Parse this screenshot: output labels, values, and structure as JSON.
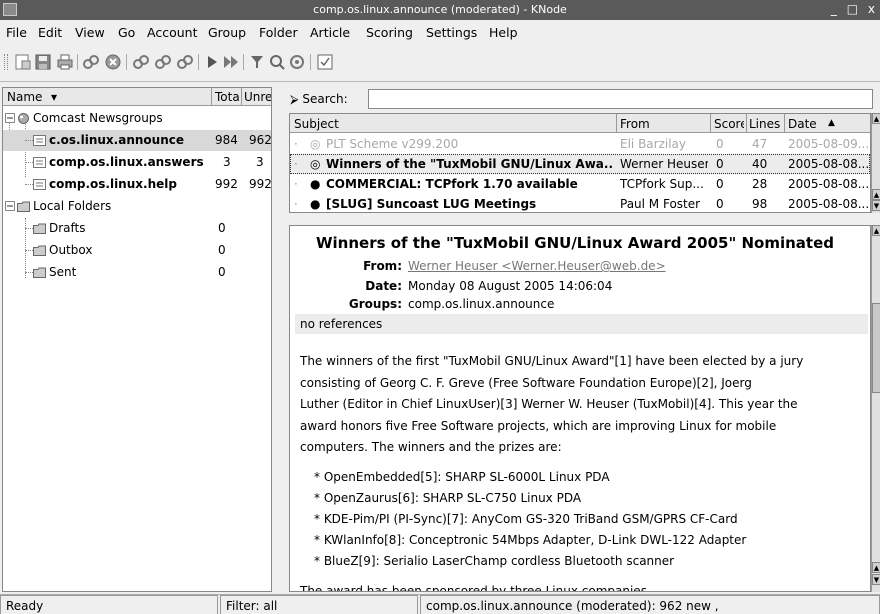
{
  "window": {
    "title": "comp.os.linux.announce (moderated) - KNode",
    "controls": "_ □ x"
  },
  "menu": [
    "File",
    "Edit",
    "View",
    "Go",
    "Account",
    "Group",
    "Folder",
    "Article",
    "Scoring",
    "Settings",
    "Help"
  ],
  "folders": {
    "columns": [
      "Name",
      "Tota",
      "Unread"
    ],
    "items": [
      {
        "name": "Comcast Newsgroups",
        "total": "",
        "unread": ""
      },
      {
        "name": "c.os.linux.announce",
        "total": "984",
        "unread": "962"
      },
      {
        "name": "comp.os.linux.answers",
        "total": "3",
        "unread": "3"
      },
      {
        "name": "comp.os.linux.help",
        "total": "992",
        "unread": "992"
      },
      {
        "name": "Local Folders",
        "total": "",
        "unread": ""
      },
      {
        "name": "Drafts",
        "total": "0",
        "unread": ""
      },
      {
        "name": "Outbox",
        "total": "0",
        "unread": ""
      },
      {
        "name": "Sent",
        "total": "0",
        "unread": ""
      }
    ]
  },
  "search": {
    "label": "Search:",
    "value": ""
  },
  "articles": {
    "columns": [
      "Subject",
      "From",
      "Score",
      "Lines",
      "Date"
    ],
    "sort_indicator": "▲",
    "rows": [
      {
        "subject": "PLT Scheme v299.200",
        "from": "Eli Barzilay",
        "score": "0",
        "lines": "47",
        "date": "2005-08-09...",
        "state": "read"
      },
      {
        "subject": "Winners of the \"TuxMobil GNU/Linux Awa...",
        "from": "Werner Heuser",
        "score": "0",
        "lines": "40",
        "date": "2005-08-08...",
        "state": "current"
      },
      {
        "subject": "COMMERCIAL: TCPfork 1.70 available",
        "from": "TCPfork Sup...",
        "score": "0",
        "lines": "28",
        "date": "2005-08-08...",
        "state": "unread"
      },
      {
        "subject": "[SLUG] Suncoast LUG Meetings",
        "from": "Paul M Foster",
        "score": "0",
        "lines": "98",
        "date": "2005-08-08...",
        "state": "unread"
      }
    ]
  },
  "article": {
    "title": "Winners of the \"TuxMobil GNU/Linux Award 2005\" Nominated",
    "from_label": "From:",
    "from": "Werner Heuser <Werner.Heuser@web.de>",
    "date_label": "Date:",
    "date": "Monday 08 August 2005 14:06:04",
    "groups_label": "Groups:",
    "groups": "comp.os.linux.announce",
    "references": "no references",
    "body_lines": [
      "The winners of the first \"TuxMobil GNU/Linux Award\"[1] have been elected by a jury",
      "consisting of Georg C. F. Greve (Free Software Foundation Europe)[2], Joerg",
      "Luther (Editor in Chief LinuxUser)[3] Werner W. Heuser (TuxMobil)[4]. This year the",
      "award honors five Free Software projects, which are improving Linux for mobile",
      "computers. The winners and the prizes are:",
      "",
      "* OpenEmbedded[5]: SHARP SL-6000L Linux PDA",
      "* OpenZaurus[6]: SHARP SL-C750 Linux PDA",
      "* KDE-Pim/PI (PI-Sync)[7]: AnyCom GS-320 TriBand GSM/GPRS CF-Card",
      "* KWlanInfo[8]: Conceptronic 54Mbps Adapter, D-Link DWL-122 Adapter",
      "* BlueZ[9]: Serialio LaserChamp cordless Bluetooth scanner",
      "",
      "The award has been sponsored by three Linux companies"
    ]
  },
  "status": {
    "left": "Ready",
    "filter": "Filter: all",
    "group": "comp.os.linux.announce (moderated): 962 new ,"
  }
}
